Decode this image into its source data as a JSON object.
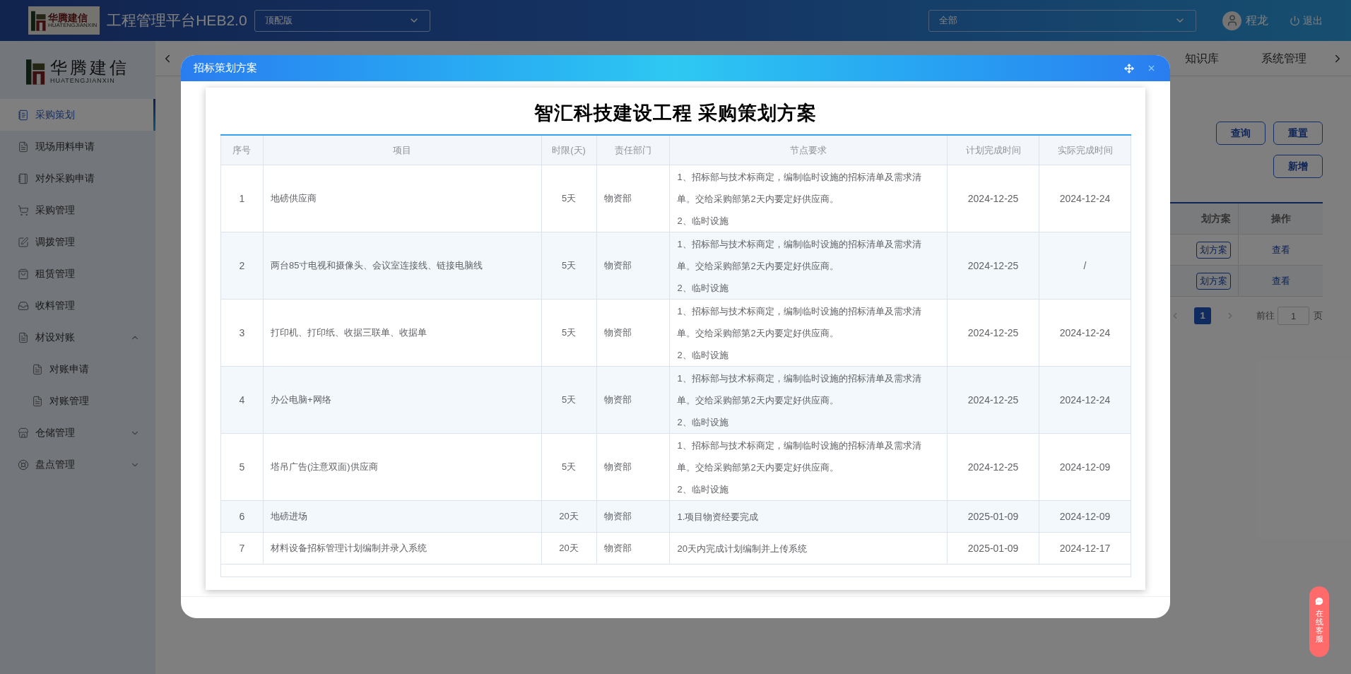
{
  "header": {
    "logo": {
      "name": "华腾建信",
      "latin": "HUATENGJIANXIN"
    },
    "app_title": "工程管理平台HEB2.0",
    "version_select": {
      "value": "顶配版"
    },
    "scope_select": {
      "value": "全部"
    },
    "user": {
      "name": "程龙"
    },
    "logout": "退出"
  },
  "sidebar": {
    "logo": {
      "name": "华腾建信",
      "latin": "HUATENGJIANXIN"
    },
    "items": [
      {
        "label": "采购策划",
        "selected": true
      },
      {
        "label": "现场用料申请",
        "selected": false
      },
      {
        "label": "对外采购申请",
        "selected": false
      },
      {
        "label": "采购管理",
        "selected": false
      },
      {
        "label": "调拨管理",
        "selected": false
      },
      {
        "label": "租赁管理",
        "selected": false
      },
      {
        "label": "收料管理",
        "selected": false
      },
      {
        "label": "材设对账",
        "selected": false,
        "expanded": true,
        "children": [
          {
            "label": "对账申请",
            "selected": false
          },
          {
            "label": "对账管理",
            "selected": false
          }
        ]
      },
      {
        "label": "仓储管理",
        "selected": false,
        "expanded": false
      },
      {
        "label": "盘点管理",
        "selected": false,
        "expanded": false
      }
    ]
  },
  "nav_tabs": [
    "知识库",
    "系统管理"
  ],
  "page": {
    "buttons": [
      "查询",
      "重置",
      "新增"
    ],
    "table": {
      "columns": [
        "划方案",
        "操作"
      ],
      "rows": [
        {
          "plan": "划方案",
          "action": "查看"
        },
        {
          "plan": "划方案",
          "action": "查看"
        }
      ]
    },
    "pagination": {
      "pages": [
        {
          "label": "1",
          "selected": true
        }
      ],
      "goto_label": "前往",
      "goto_value": "1",
      "page_unit": "页"
    }
  },
  "dialog": {
    "title": "招标策划方案",
    "heading": "智汇科技建设工程 采购策划方案",
    "columns": [
      "序号",
      "项目",
      "时限(天)",
      "责任部门",
      "节点要求",
      "计划完成时间",
      "实际完成时间"
    ],
    "rows": [
      {
        "no": "1",
        "item": "地磅供应商",
        "days": "5天",
        "dept": "物资部",
        "requirements": [
          "1、招标部与技术标商定，编制临时设施的招标清单及需求清单。交给采购部第2天内要定好供应商。",
          "2、临时设施"
        ],
        "planned": "2024-12-25",
        "actual": "2024-12-24"
      },
      {
        "no": "2",
        "item": "两台85寸电视和摄像头、会议室连接线、链接电脑线",
        "days": "5天",
        "dept": "物资部",
        "requirements": [
          "1、招标部与技术标商定，编制临时设施的招标清单及需求清单。交给采购部第2天内要定好供应商。",
          "2、临时设施"
        ],
        "planned": "2024-12-25",
        "actual": "/"
      },
      {
        "no": "3",
        "item": "打印机、打印纸、收据三联单、收据单",
        "days": "5天",
        "dept": "物资部",
        "requirements": [
          "1、招标部与技术标商定，编制临时设施的招标清单及需求清单。交给采购部第2天内要定好供应商。",
          "2、临时设施"
        ],
        "planned": "2024-12-25",
        "actual": "2024-12-24"
      },
      {
        "no": "4",
        "item": "办公电脑+网络",
        "days": "5天",
        "dept": "物资部",
        "requirements": [
          "1、招标部与技术标商定，编制临时设施的招标清单及需求清单。交给采购部第2天内要定好供应商。",
          "2、临时设施"
        ],
        "planned": "2024-12-25",
        "actual": "2024-12-24"
      },
      {
        "no": "5",
        "item": "塔吊广告(注意双面)供应商",
        "days": "5天",
        "dept": "物资部",
        "requirements": [
          "1、招标部与技术标商定，编制临时设施的招标清单及需求清单。交给采购部第2天内要定好供应商。",
          "2、临时设施"
        ],
        "planned": "2024-12-25",
        "actual": "2024-12-09"
      },
      {
        "no": "6",
        "item": "地磅进场",
        "days": "20天",
        "dept": "物资部",
        "requirements": [
          "1.项目物资经要完成"
        ],
        "planned": "2025-01-09",
        "actual": "2024-12-09"
      },
      {
        "no": "7",
        "item": "材料设备招标管理计划编制并录入系统",
        "days": "20天",
        "dept": "物资部",
        "requirements": [
          "20天内完成计划编制并上传系统"
        ],
        "planned": "2025-01-09",
        "actual": "2024-12-17"
      }
    ]
  },
  "chat_widget": {
    "label": "在线客服"
  }
}
